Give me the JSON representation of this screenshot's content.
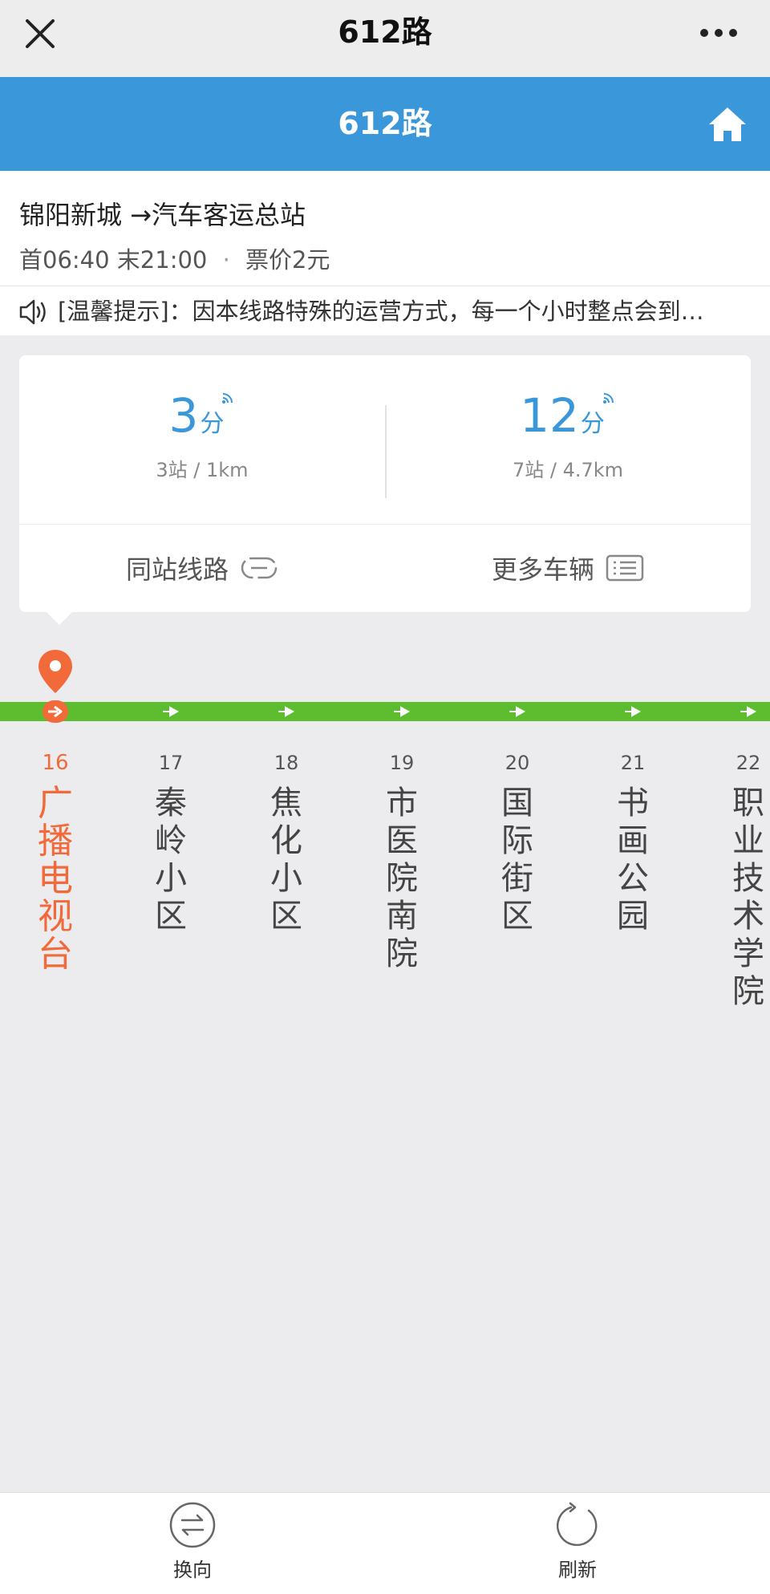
{
  "topbar": {
    "title": "612路"
  },
  "header": {
    "title": "612路"
  },
  "route": {
    "direction": "锦阳新城 →汽车客运总站",
    "first_label": "首06:40",
    "last_label": "末21:00",
    "separator": "·",
    "fare_label": "票价2元"
  },
  "notice": {
    "text": "[温馨提示]：因本线路特殊的运营方式，每一个小时整点会到…"
  },
  "arrivals": [
    {
      "minutes": "3",
      "unit": "分",
      "detail": "3站 / 1km"
    },
    {
      "minutes": "12",
      "unit": "分",
      "detail": "7站 / 4.7km"
    }
  ],
  "actions": {
    "same_stop_routes": "同站线路",
    "more_vehicles": "更多车辆"
  },
  "stops": [
    {
      "num": "16",
      "name": "广播电视台",
      "current": true
    },
    {
      "num": "17",
      "name": "秦岭小区"
    },
    {
      "num": "18",
      "name": "焦化小区"
    },
    {
      "num": "19",
      "name": "市医院南院"
    },
    {
      "num": "20",
      "name": "国际街区"
    },
    {
      "num": "21",
      "name": "书画公园"
    },
    {
      "num": "22",
      "name": "职业技术学院"
    }
  ],
  "bottom": {
    "reverse_label": "换向",
    "refresh_label": "刷新"
  },
  "colors": {
    "accent": "#3a97d9",
    "line": "#5dbd2e",
    "current": "#f26a3a"
  }
}
